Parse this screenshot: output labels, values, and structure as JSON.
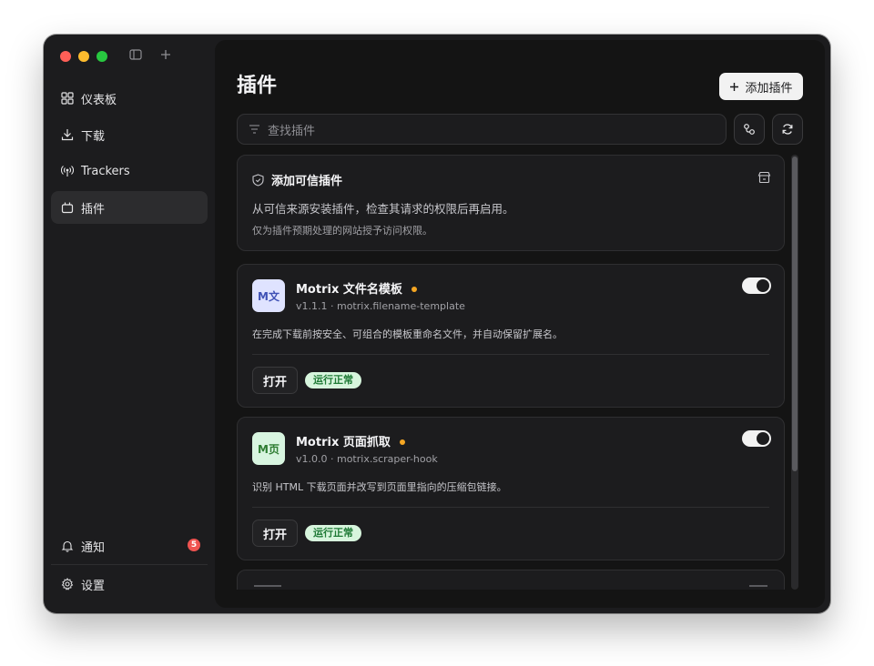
{
  "sidebar": {
    "toolbar": {
      "layout_icon": "sidebar-toggle-icon",
      "new_icon": "plus-icon"
    },
    "items": [
      {
        "label": "仪表板",
        "icon": "grid-icon",
        "active": false
      },
      {
        "label": "下载",
        "icon": "download-icon",
        "active": false
      },
      {
        "label": "Trackers",
        "icon": "broadcast-icon",
        "active": false
      },
      {
        "label": "插件",
        "icon": "plugin-icon",
        "active": true
      }
    ],
    "notifications": {
      "label": "通知",
      "count": "5"
    },
    "settings": {
      "label": "设置"
    }
  },
  "main": {
    "title": "插件",
    "add_button": "添加插件",
    "search": {
      "placeholder": "查找插件"
    }
  },
  "trust_card": {
    "title": "添加可信插件",
    "line1": "从可信来源安装插件，检查其请求的权限后再启用。",
    "line2": "仅为插件预期处理的网站授予访问权限。"
  },
  "plugins": [
    {
      "icon_text": "M文",
      "icon_bg": "#dfe3ff",
      "icon_color": "#3f51b5",
      "name": "Motrix 文件名模板",
      "meta": "v1.1.1 · motrix.filename-template",
      "description": "在完成下载前按安全、可组合的模板重命名文件，并自动保留扩展名。",
      "open_label": "打开",
      "status": "运行正常",
      "enabled": true
    },
    {
      "icon_text": "M页",
      "icon_bg": "#d8f5e0",
      "icon_color": "#2e7d32",
      "name": "Motrix 页面抓取",
      "meta": "v1.0.0 · motrix.scraper-hook",
      "description": "识别 HTML 下载页面并改写到页面里指向的压缩包链接。",
      "open_label": "打开",
      "status": "运行正常",
      "enabled": true
    }
  ],
  "colors": {
    "accent_status_bg": "#d7f5dd",
    "accent_status_text": "#1f7a36",
    "badge": "#ef5350",
    "pending_dot": "#f5a623"
  }
}
